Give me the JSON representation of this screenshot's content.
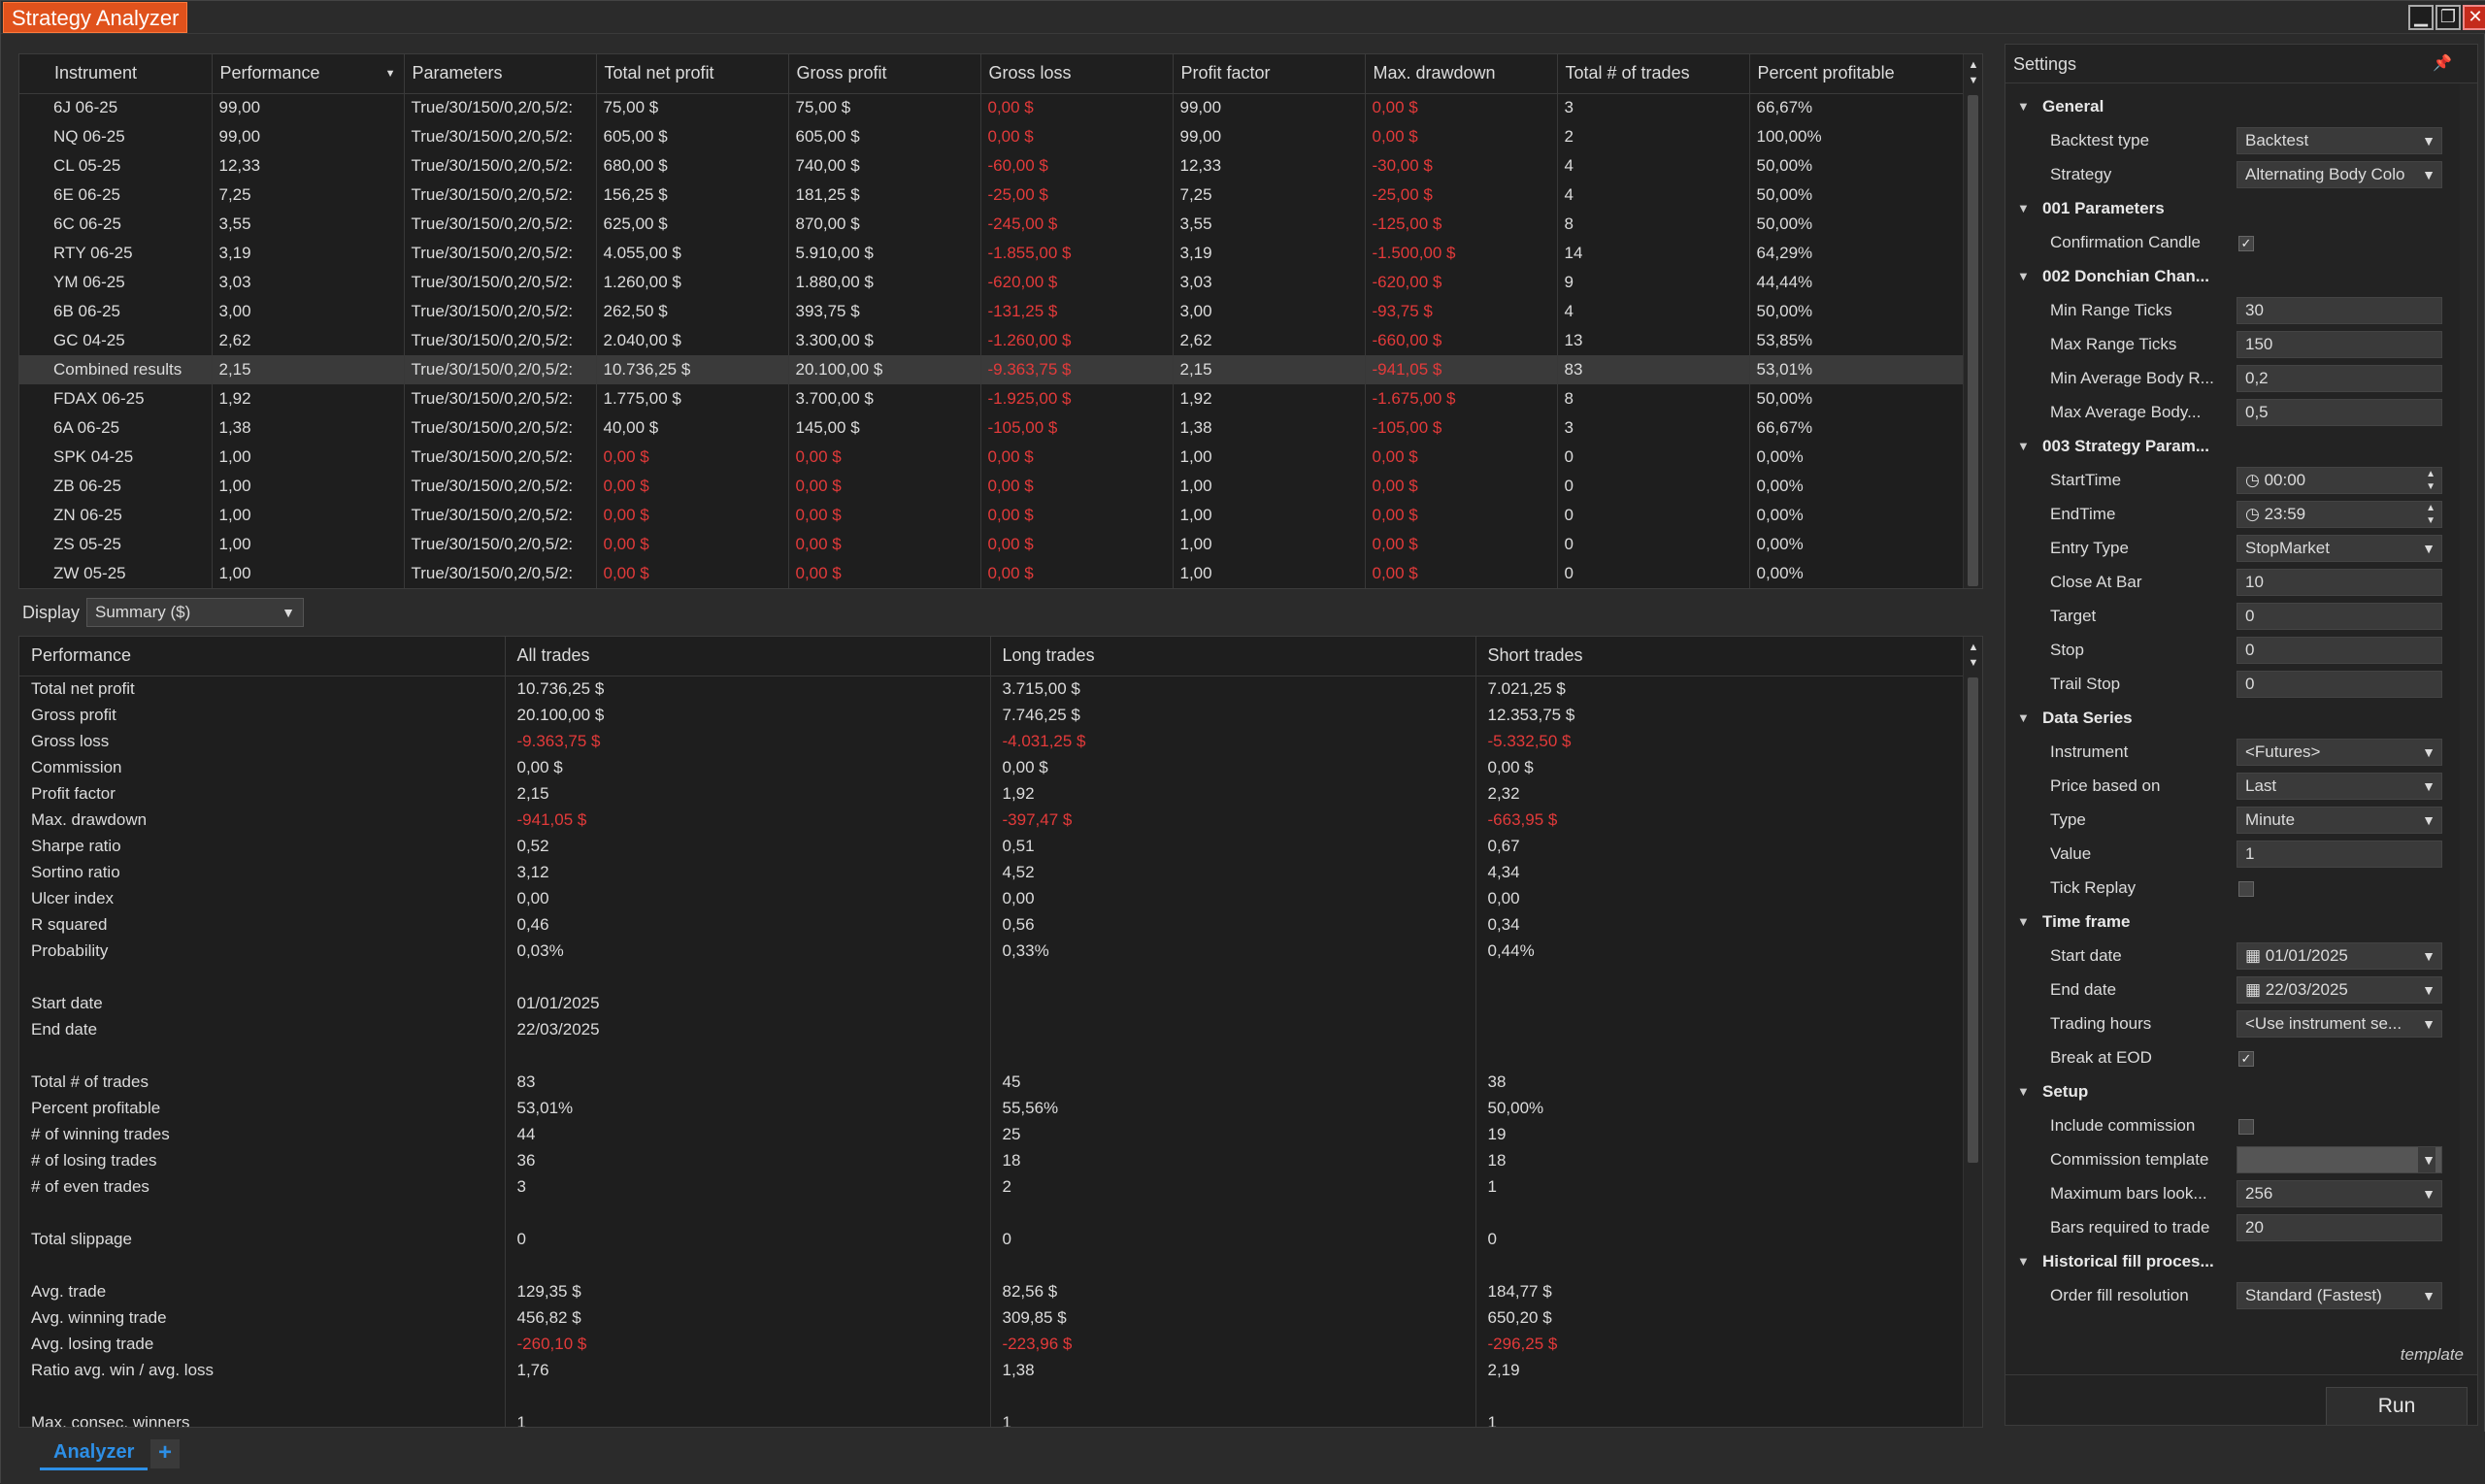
{
  "window": {
    "title": "Strategy Analyzer"
  },
  "results": {
    "columns": [
      "Instrument",
      "Performance",
      "Parameters",
      "Total net profit",
      "Gross profit",
      "Gross loss",
      "Profit factor",
      "Max. drawdown",
      "Total # of trades",
      "Percent profitable"
    ],
    "rows": [
      [
        "6J 06-25",
        "99,00",
        "True/30/150/0,2/0,5/2:",
        "75,00 $",
        "75,00 $",
        "0,00 $",
        "99,00",
        "0,00 $",
        "3",
        "66,67%"
      ],
      [
        "NQ 06-25",
        "99,00",
        "True/30/150/0,2/0,5/2:",
        "605,00 $",
        "605,00 $",
        "0,00 $",
        "99,00",
        "0,00 $",
        "2",
        "100,00%"
      ],
      [
        "CL 05-25",
        "12,33",
        "True/30/150/0,2/0,5/2:",
        "680,00 $",
        "740,00 $",
        "-60,00 $",
        "12,33",
        "-30,00 $",
        "4",
        "50,00%"
      ],
      [
        "6E 06-25",
        "7,25",
        "True/30/150/0,2/0,5/2:",
        "156,25 $",
        "181,25 $",
        "-25,00 $",
        "7,25",
        "-25,00 $",
        "4",
        "50,00%"
      ],
      [
        "6C 06-25",
        "3,55",
        "True/30/150/0,2/0,5/2:",
        "625,00 $",
        "870,00 $",
        "-245,00 $",
        "3,55",
        "-125,00 $",
        "8",
        "50,00%"
      ],
      [
        "RTY 06-25",
        "3,19",
        "True/30/150/0,2/0,5/2:",
        "4.055,00 $",
        "5.910,00 $",
        "-1.855,00 $",
        "3,19",
        "-1.500,00 $",
        "14",
        "64,29%"
      ],
      [
        "YM 06-25",
        "3,03",
        "True/30/150/0,2/0,5/2:",
        "1.260,00 $",
        "1.880,00 $",
        "-620,00 $",
        "3,03",
        "-620,00 $",
        "9",
        "44,44%"
      ],
      [
        "6B 06-25",
        "3,00",
        "True/30/150/0,2/0,5/2:",
        "262,50 $",
        "393,75 $",
        "-131,25 $",
        "3,00",
        "-93,75 $",
        "4",
        "50,00%"
      ],
      [
        "GC 04-25",
        "2,62",
        "True/30/150/0,2/0,5/2:",
        "2.040,00 $",
        "3.300,00 $",
        "-1.260,00 $",
        "2,62",
        "-660,00 $",
        "13",
        "53,85%"
      ],
      [
        "Combined results",
        "2,15",
        "True/30/150/0,2/0,5/2:",
        "10.736,25 $",
        "20.100,00 $",
        "-9.363,75 $",
        "2,15",
        "-941,05 $",
        "83",
        "53,01%"
      ],
      [
        "FDAX 06-25",
        "1,92",
        "True/30/150/0,2/0,5/2:",
        "1.775,00 $",
        "3.700,00 $",
        "-1.925,00 $",
        "1,92",
        "-1.675,00 $",
        "8",
        "50,00%"
      ],
      [
        "6A 06-25",
        "1,38",
        "True/30/150/0,2/0,5/2:",
        "40,00 $",
        "145,00 $",
        "-105,00 $",
        "1,38",
        "-105,00 $",
        "3",
        "66,67%"
      ],
      [
        "SPK 04-25",
        "1,00",
        "True/30/150/0,2/0,5/2:",
        "0,00 $",
        "0,00 $",
        "0,00 $",
        "1,00",
        "0,00 $",
        "0",
        "0,00%"
      ],
      [
        "ZB 06-25",
        "1,00",
        "True/30/150/0,2/0,5/2:",
        "0,00 $",
        "0,00 $",
        "0,00 $",
        "1,00",
        "0,00 $",
        "0",
        "0,00%"
      ],
      [
        "ZN 06-25",
        "1,00",
        "True/30/150/0,2/0,5/2:",
        "0,00 $",
        "0,00 $",
        "0,00 $",
        "1,00",
        "0,00 $",
        "0",
        "0,00%"
      ],
      [
        "ZS 05-25",
        "1,00",
        "True/30/150/0,2/0,5/2:",
        "0,00 $",
        "0,00 $",
        "0,00 $",
        "1,00",
        "0,00 $",
        "0",
        "0,00%"
      ],
      [
        "ZW 05-25",
        "1,00",
        "True/30/150/0,2/0,5/2:",
        "0,00 $",
        "0,00 $",
        "0,00 $",
        "1,00",
        "0,00 $",
        "0",
        "0,00%"
      ]
    ],
    "selected_row": 9,
    "negative_color": "#e23a3a"
  },
  "display": {
    "label": "Display",
    "value": "Summary ($)"
  },
  "performance": {
    "columns": [
      "Performance",
      "All trades",
      "Long trades",
      "Short trades"
    ],
    "rows": [
      [
        "Total net profit",
        "10.736,25 $",
        "3.715,00 $",
        "7.021,25 $"
      ],
      [
        "Gross profit",
        "20.100,00 $",
        "7.746,25 $",
        "12.353,75 $"
      ],
      [
        "Gross loss",
        "-9.363,75 $",
        "-4.031,25 $",
        "-5.332,50 $"
      ],
      [
        "Commission",
        "0,00 $",
        "0,00 $",
        "0,00 $"
      ],
      [
        "Profit factor",
        "2,15",
        "1,92",
        "2,32"
      ],
      [
        "Max. drawdown",
        "-941,05 $",
        "-397,47 $",
        "-663,95 $"
      ],
      [
        "Sharpe ratio",
        "0,52",
        "0,51",
        "0,67"
      ],
      [
        "Sortino ratio",
        "3,12",
        "4,52",
        "4,34"
      ],
      [
        "Ulcer index",
        "0,00",
        "0,00",
        "0,00"
      ],
      [
        "R squared",
        "0,46",
        "0,56",
        "0,34"
      ],
      [
        "Probability",
        "0,03%",
        "0,33%",
        "0,44%"
      ],
      [
        "",
        "",
        "",
        ""
      ],
      [
        "Start date",
        "01/01/2025",
        "",
        ""
      ],
      [
        "End date",
        "22/03/2025",
        "",
        ""
      ],
      [
        "",
        "",
        "",
        ""
      ],
      [
        "Total # of trades",
        "83",
        "45",
        "38"
      ],
      [
        "Percent profitable",
        "53,01%",
        "55,56%",
        "50,00%"
      ],
      [
        "# of winning trades",
        "44",
        "25",
        "19"
      ],
      [
        "# of losing trades",
        "36",
        "18",
        "18"
      ],
      [
        "# of even trades",
        "3",
        "2",
        "1"
      ],
      [
        "",
        "",
        "",
        ""
      ],
      [
        "Total slippage",
        "0",
        "0",
        "0"
      ],
      [
        "",
        "",
        "",
        ""
      ],
      [
        "Avg. trade",
        "129,35 $",
        "82,56 $",
        "184,77 $"
      ],
      [
        "Avg. winning trade",
        "456,82 $",
        "309,85 $",
        "650,20 $"
      ],
      [
        "Avg. losing trade",
        "-260,10 $",
        "-223,96 $",
        "-296,25 $"
      ],
      [
        "Ratio avg. win / avg. loss",
        "1,76",
        "1,38",
        "2,19"
      ],
      [
        "",
        "",
        "",
        ""
      ],
      [
        "Max. consec. winners",
        "1",
        "1",
        "1"
      ]
    ]
  },
  "settings": {
    "title": "Settings",
    "items": [
      {
        "kind": "cat",
        "label": "General"
      },
      {
        "kind": "select",
        "label": "Backtest type",
        "value": "Backtest"
      },
      {
        "kind": "select",
        "label": "Strategy",
        "value": "Alternating Body Colo"
      },
      {
        "kind": "cat",
        "label": "001 Parameters"
      },
      {
        "kind": "check",
        "label": "Confirmation Candle",
        "checked": true
      },
      {
        "kind": "cat",
        "label": "002 Donchian Chan..."
      },
      {
        "kind": "text",
        "label": "Min Range Ticks",
        "value": "30"
      },
      {
        "kind": "text",
        "label": "Max Range Ticks",
        "value": "150"
      },
      {
        "kind": "text",
        "label": "Min Average Body R...",
        "value": "0,2"
      },
      {
        "kind": "text",
        "label": "Max Average Body...",
        "value": "0,5"
      },
      {
        "kind": "cat",
        "label": "003 Strategy Param..."
      },
      {
        "kind": "time",
        "label": "StartTime",
        "value": "00:00"
      },
      {
        "kind": "time",
        "label": "EndTime",
        "value": "23:59"
      },
      {
        "kind": "select",
        "label": "Entry Type",
        "value": "StopMarket"
      },
      {
        "kind": "text",
        "label": "Close At Bar",
        "value": "10"
      },
      {
        "kind": "text",
        "label": "Target",
        "value": "0"
      },
      {
        "kind": "text",
        "label": "Stop",
        "value": "0"
      },
      {
        "kind": "text",
        "label": "Trail Stop",
        "value": "0"
      },
      {
        "kind": "cat",
        "label": "Data Series"
      },
      {
        "kind": "select",
        "label": "Instrument",
        "value": "<Futures>"
      },
      {
        "kind": "select",
        "label": "Price based on",
        "value": "Last"
      },
      {
        "kind": "select",
        "label": "Type",
        "value": "Minute"
      },
      {
        "kind": "text",
        "label": "Value",
        "value": "1"
      },
      {
        "kind": "check",
        "label": "Tick Replay",
        "checked": false
      },
      {
        "kind": "cat",
        "label": "Time frame"
      },
      {
        "kind": "date",
        "label": "Start date",
        "value": "01/01/2025"
      },
      {
        "kind": "date",
        "label": "End date",
        "value": "22/03/2025"
      },
      {
        "kind": "select",
        "label": "Trading hours",
        "value": "<Use instrument se..."
      },
      {
        "kind": "check",
        "label": "Break at EOD",
        "checked": true
      },
      {
        "kind": "cat",
        "label": "Setup"
      },
      {
        "kind": "check",
        "label": "Include commission",
        "checked": false
      },
      {
        "kind": "select",
        "label": "Commission template",
        "value": ""
      },
      {
        "kind": "select",
        "label": "Maximum bars look...",
        "value": "256"
      },
      {
        "kind": "text",
        "label": "Bars required to trade",
        "value": "20"
      },
      {
        "kind": "cat",
        "label": "Historical fill proces..."
      },
      {
        "kind": "select",
        "label": "Order fill resolution",
        "value": "Standard (Fastest)"
      }
    ],
    "template_label": "template",
    "run_label": "Run"
  },
  "tabs": {
    "active": "Analyzer",
    "add": "+"
  }
}
